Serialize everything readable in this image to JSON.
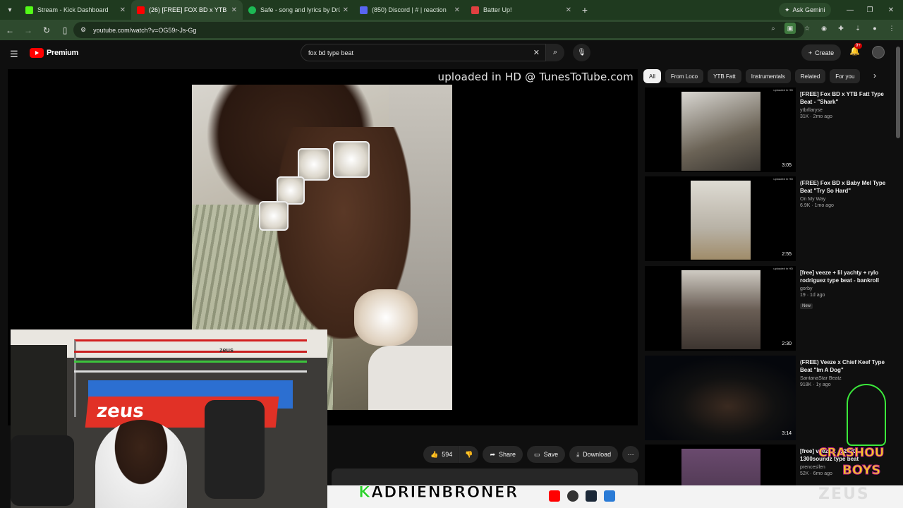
{
  "browser": {
    "tabs": [
      {
        "title": "Stream - Kick Dashboard",
        "color": "#53fc18",
        "active": false
      },
      {
        "title": "(26) [FREE] FOX BD x YTB F",
        "color": "#ff0000",
        "active": true
      },
      {
        "title": "Safe - song and lyrics by Drü C",
        "color": "#1db954",
        "active": false
      },
      {
        "title": "(850) Discord | # | reaction",
        "color": "#5865f2",
        "active": false
      },
      {
        "title": "Batter Up!",
        "color": "#e04040",
        "active": false
      }
    ],
    "gemini_label": "Ask Gemini",
    "url": "youtube.com/watch?v=OG59r-Js-Gg"
  },
  "youtube": {
    "logo_text": "Premium",
    "search_query": "fox bd type beat",
    "create_label": "Create",
    "notif_count": "9+",
    "player_watermark": "uploaded in HD @ TunesToTube.com",
    "actions": {
      "likes": "594",
      "share": "Share",
      "save": "Save",
      "download": "Download"
    },
    "chips": [
      "All",
      "From Loco",
      "YTB Fatt",
      "Instrumentals",
      "Related",
      "For you"
    ],
    "recommendations": [
      {
        "title": "[FREE] Fox BD x YTB Fatt Type Beat - \"Shark\"",
        "channel": "ytbrllaryse",
        "stats": "31K · 2mo ago",
        "duration": "3:05",
        "new": ""
      },
      {
        "title": "(FREE) Fox BD x Baby Mel Type Beat \"Try So Hard\"",
        "channel": "On My Way",
        "stats": "6.9K · 1mo ago",
        "duration": "2:55",
        "new": ""
      },
      {
        "title": "[free] veeze + lil yachty + rylo rodriguez type beat - bankroll",
        "channel": "gorby",
        "stats": "19 · 1d ago",
        "duration": "2:30",
        "new": "New"
      },
      {
        "title": "(FREE) Veeze x Chief Keef Type Beat \"Im A Dog\"",
        "channel": "SantanaStar Beatz",
        "stats": "918K · 1y ago",
        "duration": "3:14",
        "new": ""
      },
      {
        "title": "[free] veeze x ... 2020 1300soundz type beat",
        "channel": "prencesllen",
        "stats": "52K · 6mo ago",
        "duration": "",
        "new": ""
      }
    ]
  },
  "overlay": {
    "streamer_name_k": "K",
    "streamer_name_rest": "ADRIENBRONER",
    "logo_line1": "CRASHOU",
    "logo_line2": "BOYS",
    "logo_line3": "ZEUS",
    "cam_banner": "zeus"
  }
}
